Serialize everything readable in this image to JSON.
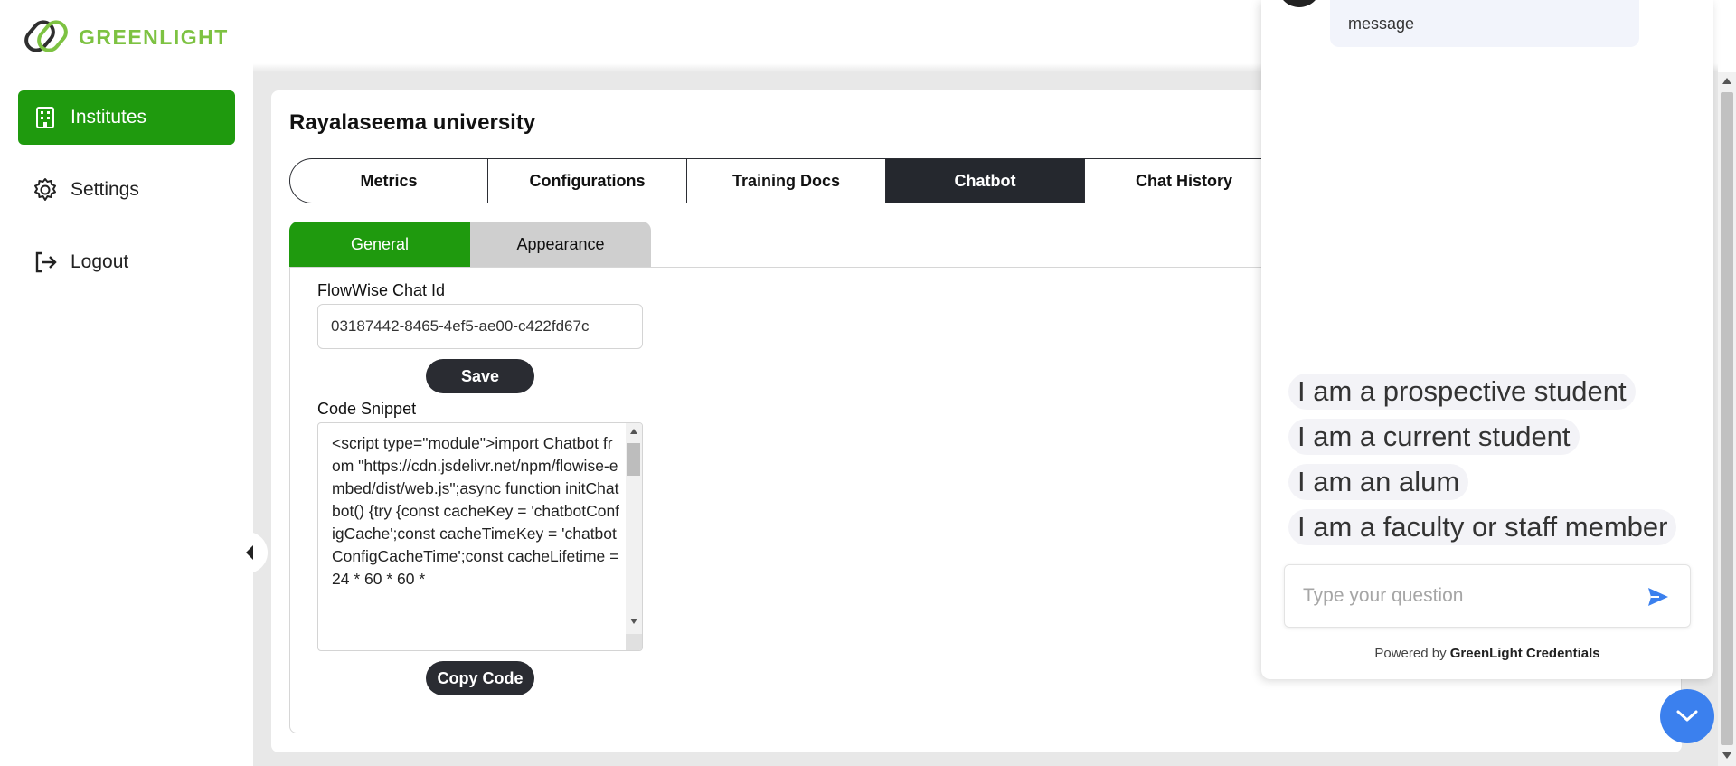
{
  "brand": {
    "name": "GREENLIGHT",
    "color": "#7dc242"
  },
  "sidebar": {
    "items": [
      {
        "label": "Institutes",
        "icon": "building-icon",
        "active": true
      },
      {
        "label": "Settings",
        "icon": "gear-icon",
        "active": false
      },
      {
        "label": "Logout",
        "icon": "logout-icon",
        "active": false
      }
    ]
  },
  "institute": {
    "title": "Rayalaseema university"
  },
  "tabs": [
    {
      "label": "Metrics"
    },
    {
      "label": "Configurations"
    },
    {
      "label": "Training Docs"
    },
    {
      "label": "Chatbot",
      "active": true
    },
    {
      "label": "Chat History"
    }
  ],
  "subtabs": [
    {
      "label": "General",
      "active": true
    },
    {
      "label": "Appearance",
      "active": false
    }
  ],
  "general": {
    "flowwise_label": "FlowWise Chat Id",
    "flowwise_value": "03187442-8465-4ef5-ae00-c422fd67c",
    "save_label": "Save",
    "code_label": "Code Snippet",
    "code_value": "<script type=\"module\">import Chatbot from \"https://cdn.jsdelivr.net/npm/flowise-embed/dist/web.js\";async function initChatbot() {try {const cacheKey = 'chatbotConfigCache';const cacheTimeKey = 'chatbotConfigCacheTime';const cacheLifetime = 24 * 60 * 60 *",
    "copy_label": "Copy Code"
  },
  "chat": {
    "last_message": "message",
    "options": [
      "I am a prospective student",
      "I am a current student",
      "I am an alum",
      "I am a faculty or staff member"
    ],
    "input_placeholder": "Type your question",
    "powered_prefix": "Powered by ",
    "powered_brand": "GreenLight Credentials"
  },
  "colors": {
    "primary_green": "#1f9a0e",
    "dark": "#25282e",
    "chat_accent": "#3b80ee"
  }
}
